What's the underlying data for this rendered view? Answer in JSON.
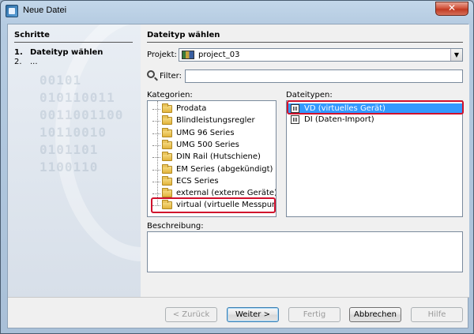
{
  "window": {
    "title": "Neue Datei",
    "close_glyph": "✕"
  },
  "steps": {
    "title": "Schritte",
    "items": [
      {
        "num": "1.",
        "label": "Dateityp wählen",
        "active": true
      },
      {
        "num": "2.",
        "label": "...",
        "active": false
      }
    ],
    "background_digits": "00101\n010110011\n0011001100\n10110010\n0101101\n1100110"
  },
  "main": {
    "title": "Dateityp wählen",
    "project_label": "Projekt:",
    "project_value": "project_03",
    "filter_label": "Filter:",
    "filter_value": "",
    "categories_label": "Kategorien:",
    "categories": [
      "Prodata",
      "Blindleistungsregler",
      "UMG 96 Series",
      "UMG 500 Series",
      "DIN Rail (Hutschiene)",
      "EM Series (abgekündigt)",
      "ECS Series",
      "external (externe Geräte)",
      "virtual (virtuelle Messpunkte)"
    ],
    "filetypes_label": "Dateitypen:",
    "filetypes": [
      {
        "label": "VD (virtuelles Gerät)",
        "selected": true
      },
      {
        "label": "DI (Daten-Import)",
        "selected": false
      }
    ],
    "description_label": "Beschreibung:",
    "description_value": ""
  },
  "buttons": {
    "back": "< Zurück",
    "next": "Weiter >",
    "finish": "Fertig",
    "cancel": "Abbrechen",
    "help": "Hilfe"
  },
  "colors": {
    "selection": "#3399ff",
    "highlight_frame": "#d0102c"
  }
}
